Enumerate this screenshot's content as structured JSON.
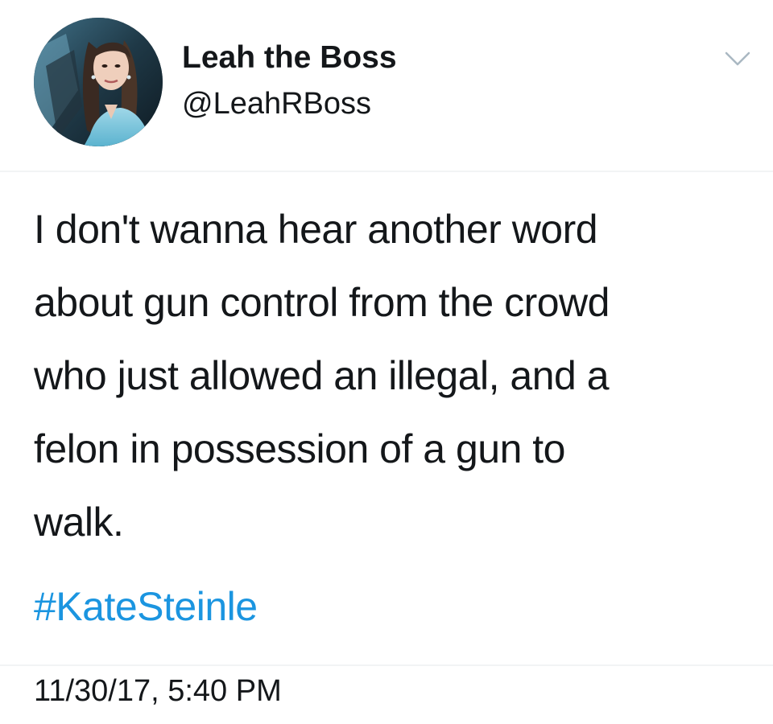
{
  "tweet": {
    "user": {
      "display_name": "Leah the Boss",
      "handle": "@LeahRBoss",
      "avatar_icon": "profile-photo-avatar"
    },
    "menu_icon": "chevron-down-icon",
    "text": "I don't wanna hear another word\nabout gun control from the crowd\nwho just allowed an illegal, and a\nfelon in possession of a gun to\nwalk.",
    "hashtag": "#KateSteinle",
    "timestamp": "11/30/17, 5:40 PM"
  },
  "colors": {
    "text": "#14171a",
    "link": "#1b95e0",
    "divider": "#f2f4f5",
    "chevron": "#aab8c2",
    "background": "#ffffff"
  }
}
